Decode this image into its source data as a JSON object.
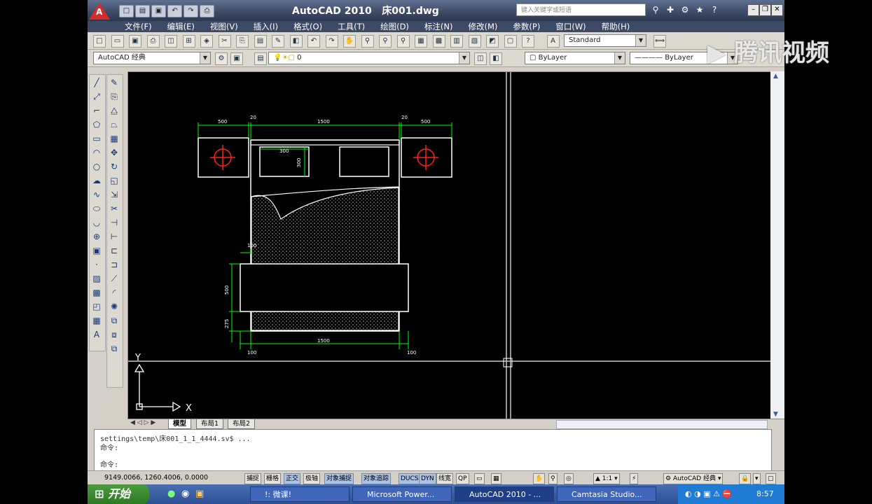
{
  "title": "AutoCAD 2010",
  "document_name": "床001.dwg",
  "search_placeholder": "键入关键字或短语",
  "quick_access": [
    "□",
    "▤",
    "▣",
    "↶",
    "↷",
    "⎙"
  ],
  "menu": [
    "文件(F)",
    "编辑(E)",
    "视图(V)",
    "插入(I)",
    "格式(O)",
    "工具(T)",
    "绘图(D)",
    "标注(N)",
    "修改(M)",
    "参数(P)",
    "窗口(W)",
    "帮助(H)"
  ],
  "toolbar": {
    "text_style": "Standard",
    "workspace": "AutoCAD 经典",
    "layer": "0",
    "color": "ByLayer",
    "linetype": "ByLayer"
  },
  "drawing": {
    "dims_top": [
      "500",
      "20",
      "1500",
      "20",
      "500"
    ],
    "dim_pillow_w": "300",
    "dim_pillow_h": "300",
    "dim_bench_top": "100",
    "dim_bench_h": "500",
    "dim_bench_low": "275",
    "dims_bottom": [
      "100",
      "1500",
      "100"
    ],
    "axis_y": "Y",
    "axis_x": "X"
  },
  "tabs": [
    "模型",
    "布局1",
    "布局2"
  ],
  "command_lines": [
    "settings\\temp\\床001_1_1_4444.sv$ ...",
    "命令:",
    "命令:"
  ],
  "coordinates": "9149.0066, 1260.4006, 0.0000",
  "status_buttons": [
    "捕捉",
    "栅格",
    "正交",
    "极轴",
    "对象捕捉",
    "对象追踪",
    "DUCS",
    "DYN",
    "线宽",
    "QP"
  ],
  "status_right": {
    "scale": "1:1",
    "workspace": "AutoCAD 经典"
  },
  "taskbar": {
    "start": "开始",
    "tasks": [
      "!: 微课!",
      "Microsoft Power...",
      "AutoCAD 2010 - ...",
      "Camtasia Studio..."
    ],
    "time": "8:57"
  },
  "watermark": "腾讯视频",
  "colors": {
    "dimension": "#00ff00",
    "outline": "#ffffff",
    "accent": "#ff2020",
    "canvas": "#000000"
  }
}
